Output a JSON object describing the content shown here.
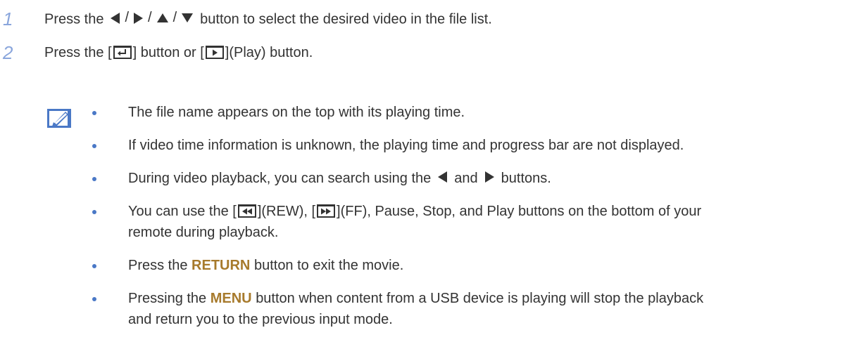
{
  "steps": [
    {
      "number": "1",
      "before": "Press the",
      "after": "button to select the desired video in the file list.",
      "arrow_separators": [
        "/",
        "/",
        "/"
      ]
    },
    {
      "number": "2",
      "before": "Press the [",
      "mid": "] button or [",
      "after": "](Play) button."
    }
  ],
  "notes": [
    {
      "text": "The file name appears on the top with its playing time."
    },
    {
      "text": "If video time information is unknown, the playing time and progress bar are not displayed."
    },
    {
      "before": "During video playback, you can search using the",
      "mid": "and",
      "after": "buttons."
    },
    {
      "p1": "You can use the [",
      "p2": "](REW), [",
      "p3": "](FF), Pause, Stop, and Play buttons on the bottom of your",
      "p4": "remote during playback."
    },
    {
      "before": "Press the",
      "keyword": "RETURN",
      "after": "button to exit the movie."
    },
    {
      "before": "Pressing the",
      "keyword": "MENU",
      "after": "button when content from a USB device is playing will stop the playback",
      "line2": "and return you to the previous input mode."
    }
  ],
  "icons": {
    "note": "note-pencil-icon",
    "directional": [
      "left-arrow-icon",
      "right-arrow-icon",
      "up-arrow-icon",
      "down-arrow-icon"
    ],
    "enter": "enter-key-icon",
    "play": "play-key-icon",
    "rewind": "rewind-key-icon",
    "fast_forward": "fast-forward-key-icon"
  },
  "colors": {
    "step_number": "#8aa6dc",
    "keyword": "#a77a2c",
    "bullet": "#4a78c6",
    "note_icon": "#4a78c6",
    "text": "#333333"
  }
}
